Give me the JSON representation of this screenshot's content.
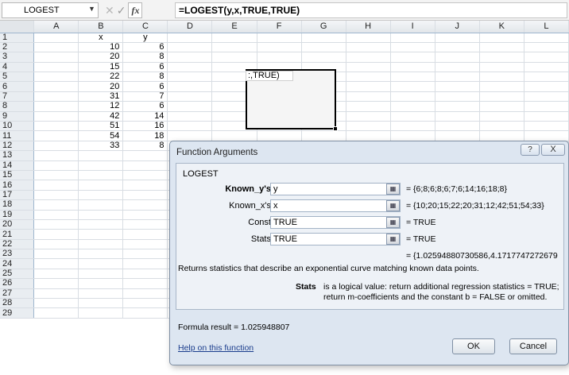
{
  "formula_bar": {
    "name_box": "LOGEST",
    "formula": "=LOGEST(y,x,TRUE,TRUE)"
  },
  "columns": [
    "A",
    "B",
    "C",
    "D",
    "E",
    "F",
    "G",
    "H",
    "I",
    "J",
    "K",
    "L"
  ],
  "rows": [
    {
      "n": "1",
      "b": "x",
      "c": "y"
    },
    {
      "n": "2",
      "b": "10",
      "c": "6"
    },
    {
      "n": "3",
      "b": "20",
      "c": "8"
    },
    {
      "n": "4",
      "b": "15",
      "c": "6"
    },
    {
      "n": "5",
      "b": "22",
      "c": "8"
    },
    {
      "n": "6",
      "b": "20",
      "c": "6"
    },
    {
      "n": "7",
      "b": "31",
      "c": "7"
    },
    {
      "n": "8",
      "b": "12",
      "c": "6"
    },
    {
      "n": "9",
      "b": "42",
      "c": "14"
    },
    {
      "n": "10",
      "b": "51",
      "c": "16"
    },
    {
      "n": "11",
      "b": "54",
      "c": "18"
    },
    {
      "n": "12",
      "b": "33",
      "c": "8"
    },
    {
      "n": "13",
      "b": "",
      "c": ""
    },
    {
      "n": "14",
      "b": "",
      "c": ""
    },
    {
      "n": "15",
      "b": "",
      "c": ""
    },
    {
      "n": "16",
      "b": "",
      "c": ""
    },
    {
      "n": "17",
      "b": "",
      "c": ""
    },
    {
      "n": "18",
      "b": "",
      "c": ""
    },
    {
      "n": "19",
      "b": "",
      "c": ""
    },
    {
      "n": "20",
      "b": "",
      "c": ""
    },
    {
      "n": "21",
      "b": "",
      "c": ""
    },
    {
      "n": "22",
      "b": "",
      "c": ""
    },
    {
      "n": "23",
      "b": "",
      "c": ""
    },
    {
      "n": "24",
      "b": "",
      "c": ""
    },
    {
      "n": "25",
      "b": "",
      "c": ""
    },
    {
      "n": "26",
      "b": "",
      "c": ""
    },
    {
      "n": "27",
      "b": "",
      "c": ""
    },
    {
      "n": "28",
      "b": "",
      "c": ""
    },
    {
      "n": "29",
      "b": "",
      "c": ""
    }
  ],
  "selection_cell_text": ":,TRUE)",
  "dialog": {
    "title": "Function Arguments",
    "help_icon": "?",
    "close_icon": "X",
    "function_name": "LOGEST",
    "args": [
      {
        "label": "Known_y's",
        "bold": true,
        "input": "y",
        "value": "=  {6;8;6;8;6;7;6;14;16;18;8}"
      },
      {
        "label": "Known_x's",
        "bold": false,
        "input": "x",
        "value": "=  {10;20;15;22;20;31;12;42;51;54;33}"
      },
      {
        "label": "Const",
        "bold": false,
        "input": "TRUE",
        "value": "=  TRUE"
      },
      {
        "label": "Stats",
        "bold": false,
        "input": "TRUE",
        "value": "=  TRUE"
      }
    ],
    "result_array": "=  {1.02594880730586,4.1717747272679",
    "description": "Returns statistics that describe an exponential curve matching known data points.",
    "param_name": "Stats",
    "param_description": "is a logical value: return additional regression statistics = TRUE; return m-coefficients and the constant b = FALSE or omitted.",
    "formula_result": "Formula result =   1.025948807",
    "help_link": "Help on this function",
    "ok_label": "OK",
    "cancel_label": "Cancel"
  }
}
